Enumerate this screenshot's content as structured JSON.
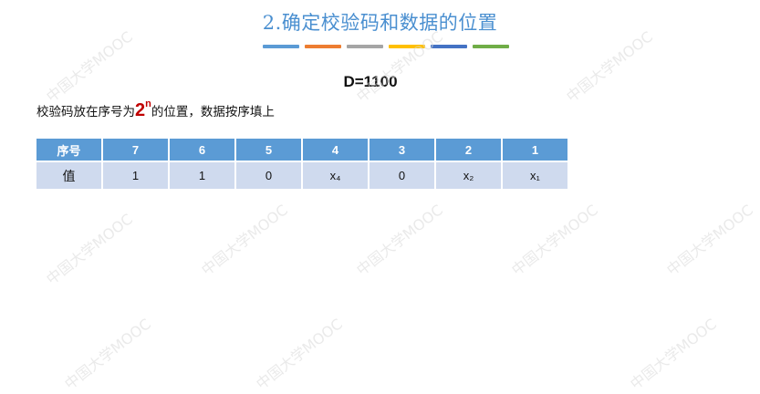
{
  "slide": {
    "title": "2.确定校验码和数据的位置",
    "formula": "D=1100",
    "instruction_before": "校验码放在序号为",
    "power_base": "2",
    "power_exp": "n",
    "instruction_after": "的位置，数据按序填上"
  },
  "deco_colors": [
    "#5B9BD5",
    "#ED7D31",
    "#A5A5A5",
    "#FFC000",
    "#4472C4",
    "#70AD47"
  ],
  "table": {
    "header": [
      "序号",
      "7",
      "6",
      "5",
      "4",
      "3",
      "2",
      "1"
    ],
    "row": [
      "值",
      "1",
      "1",
      "0",
      "x₄",
      "0",
      "x₂",
      "x₁"
    ]
  },
  "watermark_text": "中国大学MOOC"
}
